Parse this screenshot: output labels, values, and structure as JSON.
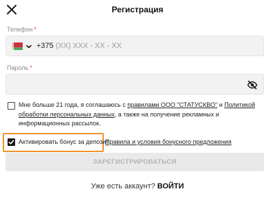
{
  "header": {
    "title": "Регистрация",
    "close_icon": "close-icon"
  },
  "phone": {
    "label": "Телефон",
    "required_mark": "*",
    "country_flag": "belarus-flag-icon",
    "prefix": "+375",
    "placeholder": "(XX) XXX - XX - XX",
    "value": ""
  },
  "password": {
    "label": "Пароль",
    "required_mark": "*",
    "value": "",
    "toggle_icon": "eye-slash-icon"
  },
  "consent": {
    "checked": false,
    "text_before": "Мне больше 21 года, я соглашаюсь с ",
    "rules_link": "правилами ООО \"СТАТУСКВО\"",
    "and": " и ",
    "privacy_link": "Политикой обработки персональных данных",
    "text_after": ", а также на получение рекламных и информационных рассылок."
  },
  "bonus": {
    "checked": true,
    "label": "Активировать бонус за депозит.",
    "terms_link": "Правила и условия бонусного предложения"
  },
  "submit": {
    "label": "ЗАРЕГИСТРИРОВАТЬСЯ"
  },
  "footer": {
    "question": "Уже есть аккаунт?",
    "login_link": "ВОЙТИ"
  },
  "colors": {
    "highlight": "#f0922a",
    "required": "#d9534f",
    "field_bg": "#f2f2f2",
    "button_disabled_bg": "#e9e9e9"
  }
}
